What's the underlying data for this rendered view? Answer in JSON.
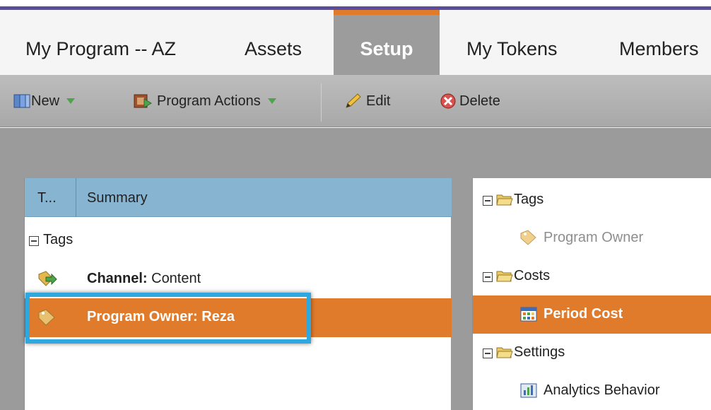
{
  "tabs": [
    {
      "label": "My Program -- AZ"
    },
    {
      "label": "Assets"
    },
    {
      "label": "Setup"
    },
    {
      "label": "My Tokens"
    },
    {
      "label": "Members"
    }
  ],
  "active_tab": "Setup",
  "toolbar": {
    "new_label": "New",
    "program_actions_label": "Program Actions",
    "edit_label": "Edit",
    "delete_label": "Delete"
  },
  "grid": {
    "col_type": "T...",
    "col_summary": "Summary",
    "group_label": "Tags",
    "rows": [
      {
        "key": "Channel:",
        "value": " Content"
      },
      {
        "key": "Program Owner:",
        "value": " Reza"
      }
    ]
  },
  "tree": {
    "tags_label": "Tags",
    "program_owner_label": "Program Owner",
    "costs_label": "Costs",
    "period_cost_label": "Period Cost",
    "settings_label": "Settings",
    "analytics_label": "Analytics Behavior"
  },
  "colors": {
    "accent_orange": "#e07b2c",
    "header_purple": "#5c4c9c",
    "highlight_blue": "#2fa8e0",
    "grid_header_blue": "#87b4d1"
  }
}
